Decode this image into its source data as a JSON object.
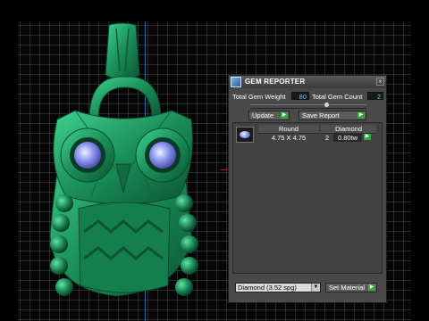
{
  "panel": {
    "title": "GEM REPORTER",
    "close_glyph": "×",
    "total_gem_weight_label": "Total Gem Weight",
    "total_gem_weight_value": "80",
    "total_gem_count_label": "Total Gem Count",
    "total_gem_count_value": "2",
    "slider_level": 0.65,
    "update_label": "Update",
    "save_report_label": "Save Report",
    "go_glyph": "▶",
    "columns": [
      "Round",
      "Diamond"
    ],
    "rows": [
      {
        "size": "4.75 X 4.75",
        "count": "2",
        "weight": "0.80tw"
      }
    ],
    "material_select": "Diamond   (3.52 spg)",
    "set_material_label": "Set Material"
  },
  "colors": {
    "accent_value": "#5fc8ff",
    "go_green": "#33a833",
    "model_green": "#1f9a64"
  },
  "icons": [
    "gem-reporter-app-icon",
    "close-icon",
    "play-arrow-icon",
    "gem-thumbnail-icon",
    "dropdown-arrow-icon"
  ]
}
